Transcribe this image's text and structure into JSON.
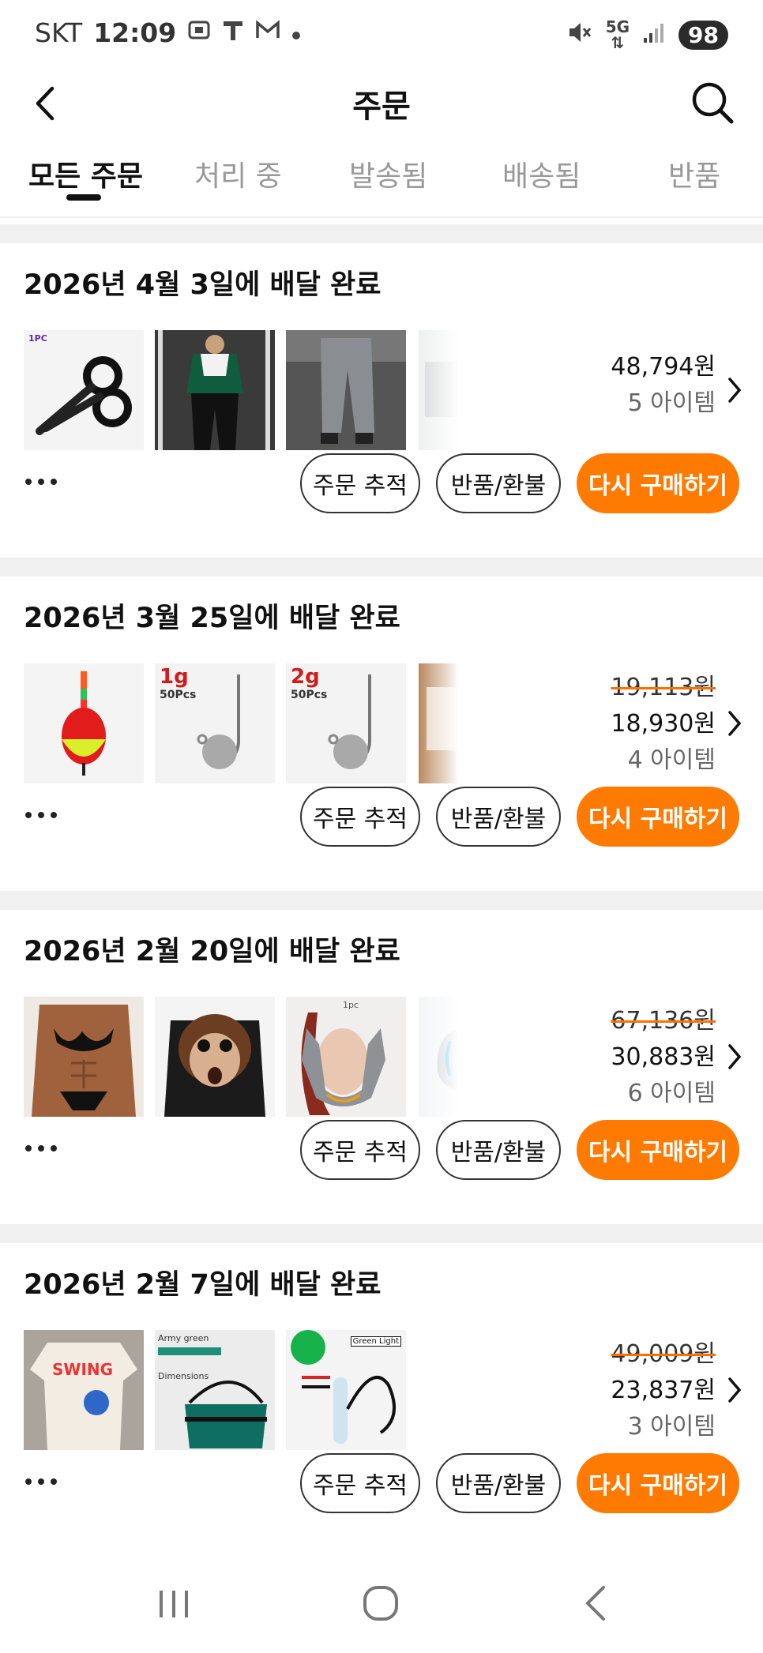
{
  "status_bar": {
    "carrier": "SKT",
    "time": "12:09",
    "battery": "98",
    "network": "5G"
  },
  "header": {
    "title": "주문"
  },
  "tabs": [
    {
      "label": "모든 주문",
      "active": true
    },
    {
      "label": "처리 중",
      "active": false
    },
    {
      "label": "발송됨",
      "active": false
    },
    {
      "label": "배송됨",
      "active": false
    },
    {
      "label": "반품",
      "active": false
    }
  ],
  "orders": [
    {
      "title": "2026년 4월 3일에 배달 완료",
      "price": "48,794원",
      "items": "5 아이템",
      "thumbnails": [
        "scissors-product",
        "tracksuit-product",
        "grey-pants-product",
        "box-product-partial"
      ],
      "thumb_caption": "1PC"
    },
    {
      "title": "2026년 3월 25일에 배달 완료",
      "price_old": "19,113원",
      "price": "18,930원",
      "items": "4 아이템",
      "thumbnails": [
        "fishing-float-product",
        "jig-head-1g-product",
        "jig-head-2g-product",
        "wood-product-partial"
      ],
      "jig1_label": "1g",
      "jig2_label": "2g",
      "jig_pcs": "50Pcs"
    },
    {
      "title": "2026년 2월 20일에 배달 완료",
      "price_old": "67,136원",
      "price": "30,883원",
      "items": "6 아이템",
      "thumbnails": [
        "muscle-bikini-tshirt-product",
        "monkey-tshirt-product",
        "face-lift-strap-product",
        "blue-product-partial"
      ],
      "face_label": "1pc"
    },
    {
      "title": "2026년 2월 7일에 배달 완료",
      "price_old": "49,009원",
      "price": "23,837원",
      "items": "3 아이템",
      "thumbnails": [
        "swing-tshirt-product",
        "fishing-bucket-product",
        "green-light-product"
      ],
      "swing_label": "SWING",
      "bucket_label": "Army green",
      "bucket_sub": "Dimensions",
      "light_label": "Green Light"
    }
  ],
  "buttons": {
    "track": "주문 추적",
    "return": "반품/환불",
    "buy_again": "다시 구매하기"
  },
  "colors": {
    "accent": "#ff7a00",
    "text": "#111111",
    "muted": "#999999"
  }
}
